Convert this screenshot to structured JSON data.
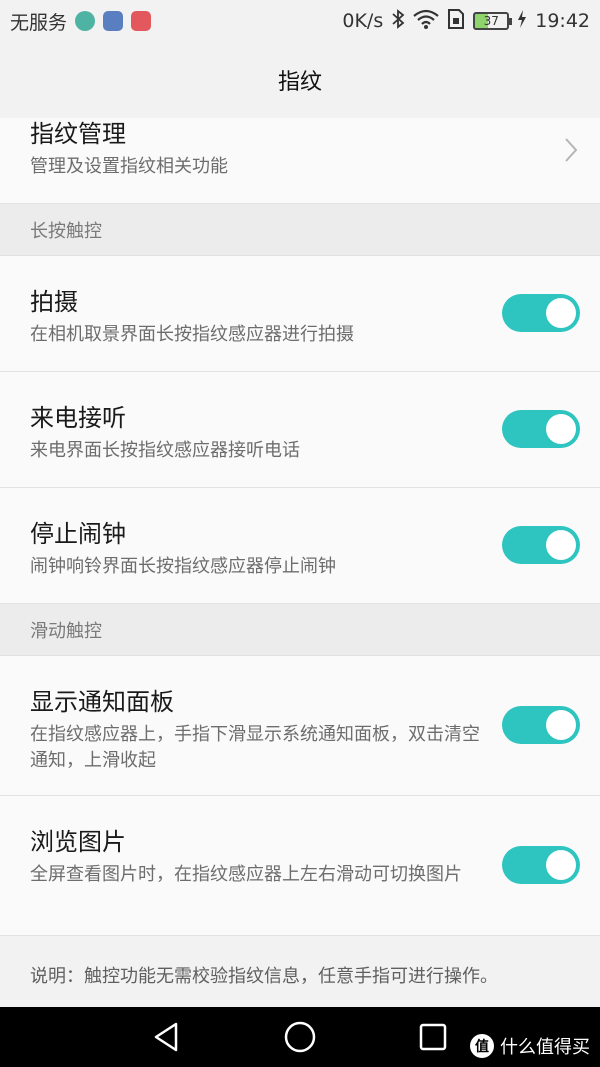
{
  "status_bar": {
    "carrier": "无服务",
    "speed": "0K/s",
    "battery": "37",
    "time": "19:42"
  },
  "header": {
    "title": "指纹"
  },
  "manage": {
    "title": "指纹管理",
    "subtitle": "管理及设置指纹相关功能"
  },
  "sections": {
    "long_press": "长按触控",
    "slide": "滑动触控"
  },
  "items": {
    "capture": {
      "title": "拍摄",
      "subtitle": "在相机取景界面长按指纹感应器进行拍摄",
      "enabled": true
    },
    "answer_call": {
      "title": "来电接听",
      "subtitle": "来电界面长按指纹感应器接听电话",
      "enabled": true
    },
    "stop_alarm": {
      "title": "停止闹钟",
      "subtitle": "闹钟响铃界面长按指纹感应器停止闹钟",
      "enabled": true
    },
    "notification_panel": {
      "title": "显示通知面板",
      "subtitle": "在指纹感应器上，手指下滑显示系统通知面板，双击清空通知，上滑收起",
      "enabled": true
    },
    "browse_photos": {
      "title": "浏览图片",
      "subtitle": "全屏查看图片时，在指纹感应器上左右滑动可切换图片",
      "enabled": true
    }
  },
  "note": "说明：触控功能无需校验指纹信息，任意手指可进行操作。",
  "watermark": {
    "badge": "值",
    "text": "什么值得买"
  },
  "colors": {
    "toggle_on": "#2ec4c0"
  }
}
